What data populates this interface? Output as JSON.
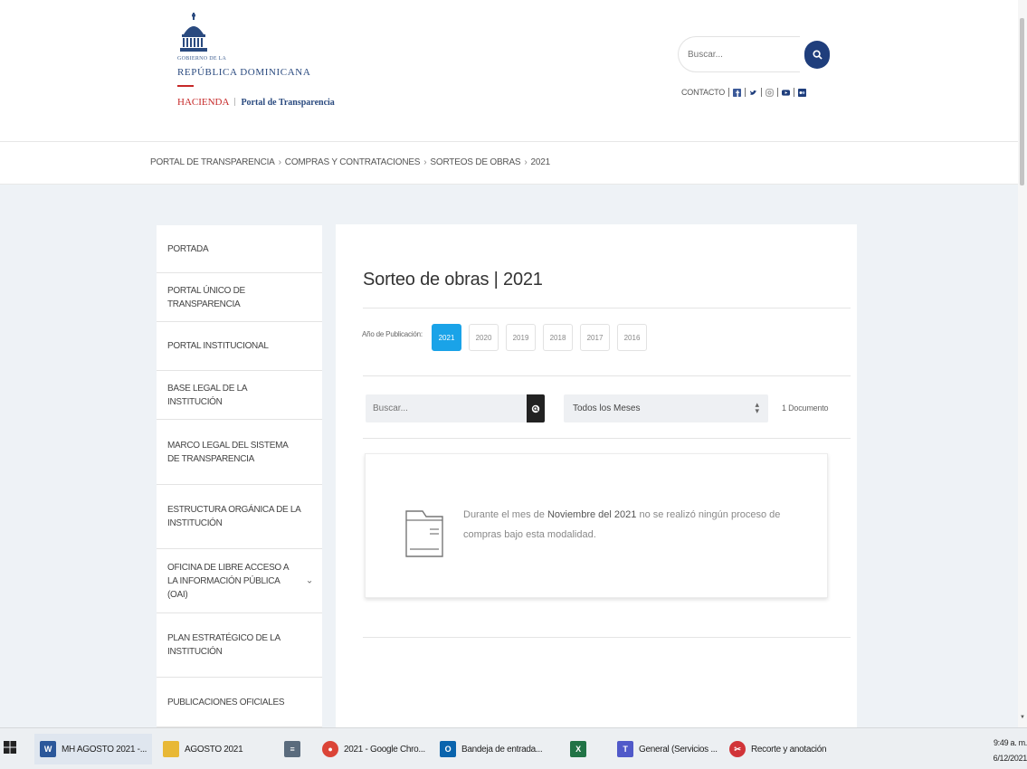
{
  "header": {
    "logo_small": "GOBIERNO DE LA",
    "logo_name": "REPÚBLICA DOMINICANA",
    "logo_hacienda": "HACIENDA",
    "logo_portal": "Portal de Transparencia",
    "search_placeholder": "Buscar...",
    "contact_label": "CONTACTO",
    "icons": [
      "facebook-icon",
      "twitter-icon",
      "instagram-icon",
      "youtube-icon",
      "flickr-icon"
    ]
  },
  "breadcrumb": [
    "PORTAL DE TRANSPARENCIA",
    "COMPRAS Y CONTRATACIONES",
    "SORTEOS DE OBRAS",
    "2021"
  ],
  "sidebar": {
    "items": [
      {
        "label": "PORTADA"
      },
      {
        "label": "PORTAL ÚNICO DE TRANSPARENCIA"
      },
      {
        "label": "PORTAL INSTITUCIONAL"
      },
      {
        "label": "BASE LEGAL DE LA INSTITUCIÓN"
      },
      {
        "label": "MARCO LEGAL DEL SISTEMA DE TRANSPARENCIA"
      },
      {
        "label": "ESTRUCTURA ORGÁNICA DE LA INSTITUCIÓN"
      },
      {
        "label": "OFICINA DE LIBRE ACCESO A LA INFORMACIÓN PÚBLICA (OAI)"
      },
      {
        "label": "PLAN ESTRATÉGICO DE LA INSTITUCIÓN"
      },
      {
        "label": "PUBLICACIONES OFICIALES"
      }
    ]
  },
  "main": {
    "title": "Sorteo de obras | 2021",
    "year_label": "Año de Publicación:",
    "years": [
      "2021",
      "2020",
      "2019",
      "2018",
      "2017",
      "2016"
    ],
    "active_year": "2021",
    "search_placeholder": "Buscar...",
    "month_selected": "Todos los Meses",
    "doc_count": "1 Documento",
    "notice_before": "Durante el mes de ",
    "notice_bold": "Noviembre del 2021",
    "notice_after": " no se realizó ningún proceso de compras bajo esta modalidad."
  },
  "taskbar": {
    "items": [
      {
        "label": "MH AGOSTO 2021 -...",
        "icon": "word-icon",
        "color": "#2b579a"
      },
      {
        "label": "AGOSTO 2021",
        "icon": "folder-icon",
        "color": "#e8b836"
      },
      {
        "label": "2021 - Google Chro...",
        "icon": "chrome-icon",
        "color": "#db4437"
      },
      {
        "label": "Bandeja de entrada...",
        "icon": "outlook-icon",
        "color": "#0a64ad"
      },
      {
        "label": "General (Servicios ...",
        "icon": "teams-icon",
        "color": "#5059c9"
      },
      {
        "label": "Recorte y anotación",
        "icon": "snip-icon",
        "color": "#d13438"
      }
    ],
    "extra_icons": [
      "document-icon",
      "excel-icon"
    ],
    "time": "9:49 a. m.",
    "date": "6/12/2021"
  },
  "colors": {
    "accent_blue": "#1aa3e8",
    "navy": "#1f3e7c",
    "brand_red": "#c62828",
    "background": "#eef2f6"
  }
}
